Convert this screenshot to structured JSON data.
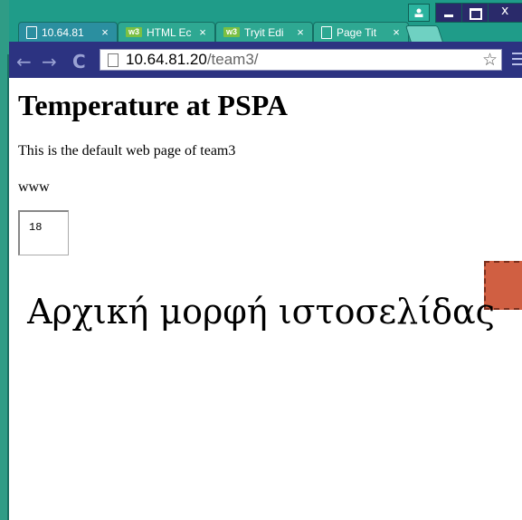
{
  "tabs": [
    {
      "title": "10.64.81",
      "icon": "page-icon",
      "active": true
    },
    {
      "title": "HTML Ec",
      "icon": "w3schools-icon",
      "active": false
    },
    {
      "title": "Tryit Edi",
      "icon": "w3schools-icon",
      "active": false
    },
    {
      "title": "Page Tit",
      "icon": "page-icon",
      "active": false
    }
  ],
  "tab_close_glyph": "×",
  "w3_icon_label": "w3",
  "toolbar": {
    "back": "←",
    "forward": "→",
    "reload": "C",
    "url_host": "10.64.81.20",
    "url_path": "/team3/",
    "star": "☆"
  },
  "page": {
    "heading": "Temperature at PSPA",
    "paragraph1": "This is the default web page of team3",
    "paragraph2": "www",
    "temperature_value": "18"
  },
  "caption": "Αρχική μορφή ιστοσελίδας",
  "colors": {
    "frame": "#1f9c89",
    "toolbar": "#2c3381",
    "orange_box": "#d05f42"
  }
}
